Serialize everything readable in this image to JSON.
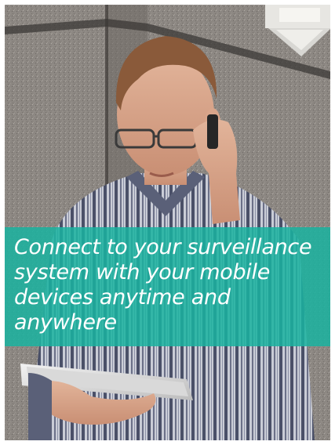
{
  "promo": {
    "headline": "Connect to your surveillance system with your mobile devices anytime and anywhere",
    "band_color": "#1ab2a0",
    "photo_icon": "man-on-phone-with-tablet-image"
  }
}
